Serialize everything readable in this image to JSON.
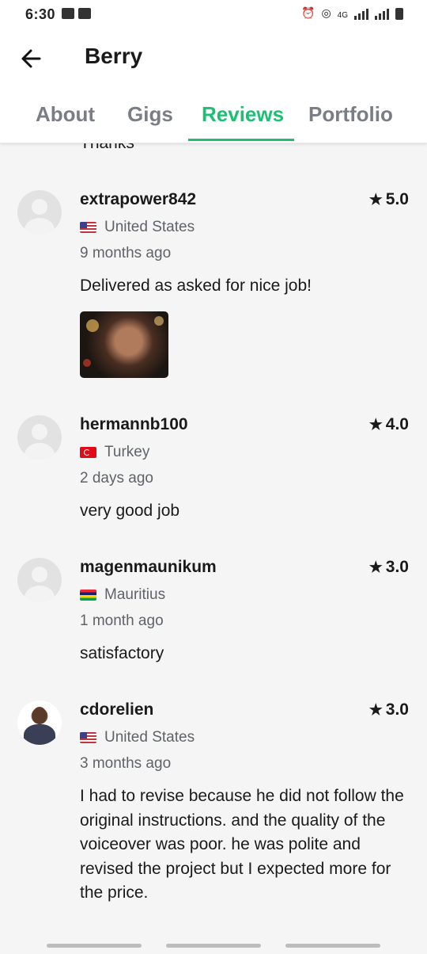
{
  "status_bar": {
    "time": "6:30",
    "network": "4G"
  },
  "header": {
    "title": "Berry",
    "back_icon": "arrow-left-icon"
  },
  "tabs": [
    {
      "label": "About"
    },
    {
      "label": "Gigs"
    },
    {
      "label": "Reviews",
      "active": true
    },
    {
      "label": "Portfolio"
    }
  ],
  "accent_color": "#1dbf73",
  "partial_text": "Thanks",
  "reviews": [
    {
      "username": "extrapower842",
      "rating": "5.0",
      "country": "United States",
      "time_ago": "9 months ago",
      "comment": "Delivered as asked for nice job!",
      "has_image": true
    },
    {
      "username": "hermannb100",
      "rating": "4.0",
      "country": "Turkey",
      "time_ago": "2 days ago",
      "comment": "very good job"
    },
    {
      "username": "magenmaunikum",
      "rating": "3.0",
      "country": "Mauritius",
      "time_ago": "1 month ago",
      "comment": "satisfactory"
    },
    {
      "username": "cdorelien",
      "rating": "3.0",
      "country": "United States",
      "time_ago": "3 months ago",
      "comment": "I had to revise because he did not follow the original instructions. and the quality of the voiceover was poor. he was polite and revised the project but I expected more for the price."
    }
  ]
}
